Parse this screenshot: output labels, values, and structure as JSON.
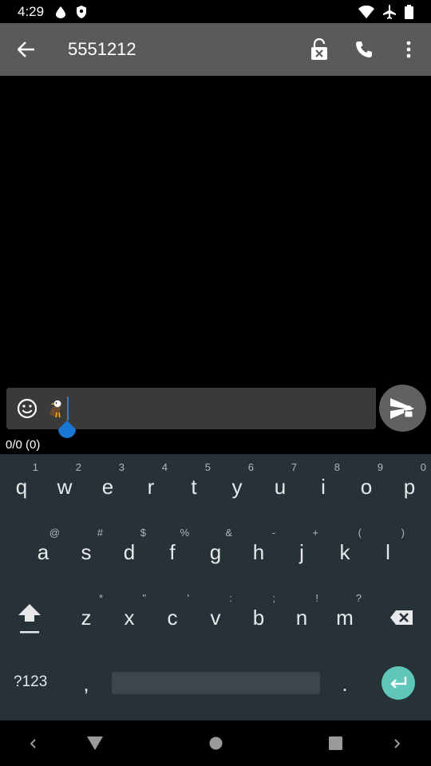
{
  "status_bar": {
    "time": "4:29",
    "icons_left": [
      "notification-drop-icon",
      "shield-icon"
    ],
    "icons_right": [
      "wifi-icon",
      "airplane-mode-icon",
      "battery-icon"
    ]
  },
  "toolbar": {
    "title": "5551212",
    "icons": [
      "back-arrow-icon",
      "unlock-icon",
      "phone-icon",
      "more-vert-icon"
    ]
  },
  "compose": {
    "emoji_icon": "emoji-smile-icon",
    "content_emoji": "🦅",
    "counter": "0/0 (0)",
    "send_icon": "send-unlocked-icon"
  },
  "keyboard": {
    "row1": [
      {
        "key": "q",
        "hint": "1"
      },
      {
        "key": "w",
        "hint": "2"
      },
      {
        "key": "e",
        "hint": "3"
      },
      {
        "key": "r",
        "hint": "4"
      },
      {
        "key": "t",
        "hint": "5"
      },
      {
        "key": "y",
        "hint": "6"
      },
      {
        "key": "u",
        "hint": "7"
      },
      {
        "key": "i",
        "hint": "8"
      },
      {
        "key": "o",
        "hint": "9"
      },
      {
        "key": "p",
        "hint": "0"
      }
    ],
    "row2": [
      {
        "key": "a",
        "hint": "@"
      },
      {
        "key": "s",
        "hint": "#"
      },
      {
        "key": "d",
        "hint": "$"
      },
      {
        "key": "f",
        "hint": "%"
      },
      {
        "key": "g",
        "hint": "&"
      },
      {
        "key": "h",
        "hint": "-"
      },
      {
        "key": "j",
        "hint": "+"
      },
      {
        "key": "k",
        "hint": "("
      },
      {
        "key": "l",
        "hint": ")"
      }
    ],
    "row3": [
      {
        "key": "z",
        "hint": "*"
      },
      {
        "key": "x",
        "hint": "\""
      },
      {
        "key": "c",
        "hint": "'"
      },
      {
        "key": "v",
        "hint": ":"
      },
      {
        "key": "b",
        "hint": ";"
      },
      {
        "key": "n",
        "hint": "!"
      },
      {
        "key": "m",
        "hint": "?"
      }
    ],
    "symbols_label": "?123",
    "comma": ",",
    "period": ".",
    "colors": {
      "background": "#263238",
      "enter": "#5fc7b9",
      "space": "#3b474d"
    }
  },
  "nav_bar": {
    "icons": [
      "nav-left-icon",
      "back-triangle-icon",
      "home-circle-icon",
      "recents-square-icon",
      "nav-right-icon"
    ]
  }
}
